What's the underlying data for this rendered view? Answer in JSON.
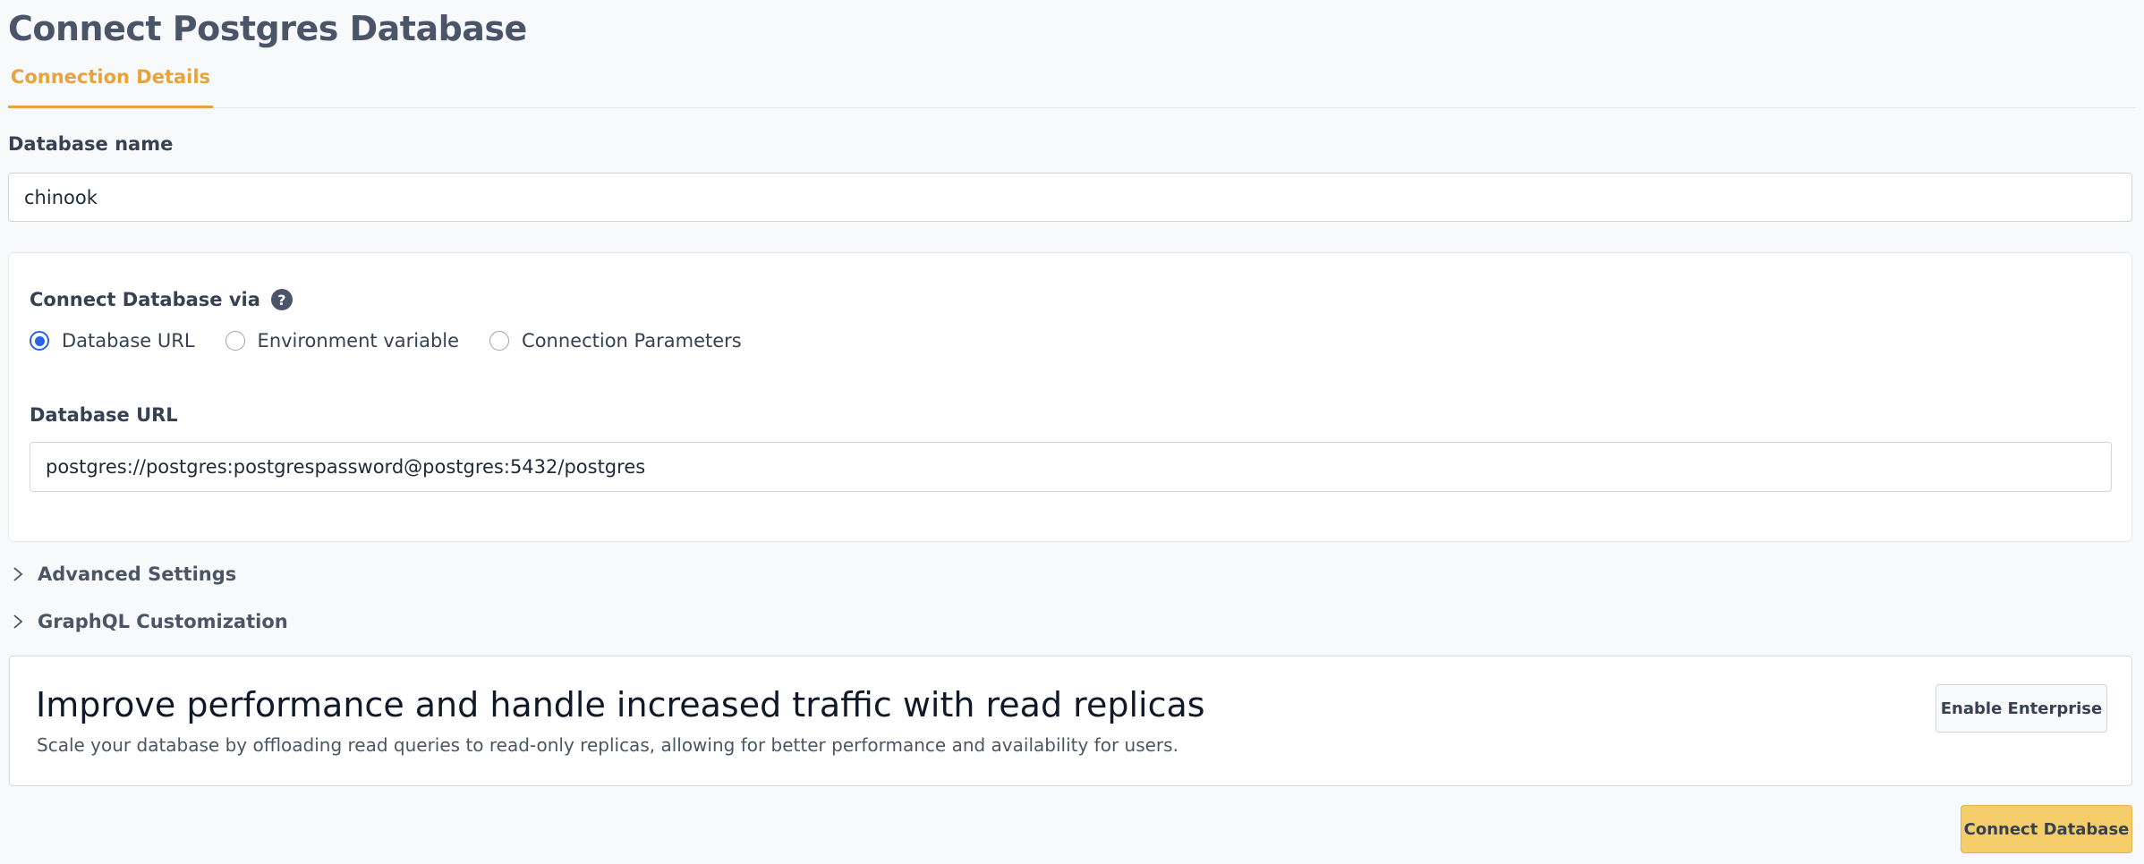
{
  "page": {
    "title": "Connect Postgres Database"
  },
  "tabs": [
    {
      "label": "Connection Details",
      "active": true
    }
  ],
  "database_name": {
    "label": "Database name",
    "value": "chinook"
  },
  "connect_via": {
    "label": "Connect Database via",
    "help_icon": "question-circle-icon",
    "options": [
      {
        "label": "Database URL",
        "checked": true
      },
      {
        "label": "Environment variable",
        "checked": false
      },
      {
        "label": "Connection Parameters",
        "checked": false
      }
    ]
  },
  "database_url": {
    "label": "Database URL",
    "value": "postgres://postgres:postgrespassword@postgres:5432/postgres"
  },
  "sections": {
    "advanced": "Advanced Settings",
    "graphql": "GraphQL Customization"
  },
  "banner": {
    "title": "Improve performance and handle increased traffic with read replicas",
    "description": "Scale your database by offloading read queries to read-only replicas, allowing for better performance and availability for users.",
    "button_label": "Enable Enterprise"
  },
  "footer": {
    "connect_label": "Connect Database"
  },
  "colors": {
    "accent": "#e8a33c",
    "radio_selected": "#2563eb",
    "primary_button": "#f5cd6b"
  }
}
